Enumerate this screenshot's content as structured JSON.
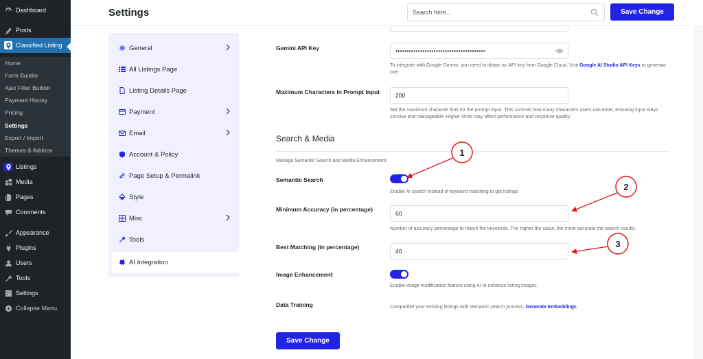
{
  "wp_menu": {
    "items": [
      {
        "id": "dashboard",
        "label": "Dashboard",
        "icon": "dashboard-icon"
      },
      {
        "id": "posts",
        "label": "Posts",
        "icon": "pin-icon"
      },
      {
        "id": "classified",
        "label": "Classified Listing",
        "icon": "location-pin-icon",
        "active": true
      },
      {
        "id": "listings",
        "label": "Listings",
        "icon": "location-pin-icon"
      },
      {
        "id": "media",
        "label": "Media",
        "icon": "media-icon"
      },
      {
        "id": "pages",
        "label": "Pages",
        "icon": "pages-icon"
      },
      {
        "id": "comments",
        "label": "Comments",
        "icon": "comment-icon"
      },
      {
        "id": "appearance",
        "label": "Appearance",
        "icon": "brush-icon"
      },
      {
        "id": "plugins",
        "label": "Plugins",
        "icon": "plug-icon"
      },
      {
        "id": "users",
        "label": "Users",
        "icon": "user-icon"
      },
      {
        "id": "tools",
        "label": "Tools",
        "icon": "wrench-icon"
      },
      {
        "id": "settings",
        "label": "Settings",
        "icon": "sliders-icon"
      },
      {
        "id": "collapse",
        "label": "Collapse Menu",
        "icon": "collapse-icon"
      }
    ],
    "submenu": [
      {
        "label": "Home",
        "current": false
      },
      {
        "label": "Form Builder",
        "current": false
      },
      {
        "label": "Ajax Filter Builder",
        "current": false
      },
      {
        "label": "Payment History",
        "current": false
      },
      {
        "label": "Pricing",
        "current": false
      },
      {
        "label": "Settings",
        "current": true
      },
      {
        "label": "Export / Import",
        "current": false
      },
      {
        "label": "Themes & Addons",
        "current": false
      }
    ]
  },
  "header": {
    "title": "Settings",
    "search_placeholder": "Search here...",
    "save_label": "Save Change"
  },
  "nav": {
    "items": [
      {
        "label": "General",
        "icon": "gear-icon",
        "has_children": true
      },
      {
        "label": "All Listings Page",
        "icon": "list-icon",
        "has_children": false
      },
      {
        "label": "Listing Details Page",
        "icon": "document-icon",
        "has_children": false
      },
      {
        "label": "Payment",
        "icon": "credit-card-icon",
        "has_children": true
      },
      {
        "label": "Email",
        "icon": "envelope-icon",
        "has_children": true
      },
      {
        "label": "Account & Policy",
        "icon": "shield-icon",
        "has_children": false
      },
      {
        "label": "Page Setup & Permalink",
        "icon": "link-icon",
        "has_children": false
      },
      {
        "label": "Style",
        "icon": "paint-bucket-icon",
        "has_children": false
      },
      {
        "label": "Misc",
        "icon": "grid-icon",
        "has_children": true
      },
      {
        "label": "Tools",
        "icon": "wrench-icon",
        "has_children": false
      },
      {
        "label": "AI Integration",
        "icon": "ai-chip-icon",
        "has_children": false,
        "active": true
      }
    ]
  },
  "content": {
    "gemini": {
      "label": "Gemini API Key",
      "value": "••••••••••••••••••••••••••••••••••••••••",
      "help_prefix": "To integrate with Google Gemini, you need to obtain an API key from Google Cloud. Visit ",
      "help_link": "Google AI Studio API Keys",
      "help_suffix": " to generate one."
    },
    "max_chars": {
      "label": "Maximum Characters in Prompt Input",
      "value": "200",
      "help": "Set the maximum character limit for the prompt input. This controls how many characters users can enter, ensuring input stays concise and manageable. Higher limits may affect performance and response quality."
    },
    "section": {
      "title": "Search & Media",
      "description": "Manage Semantic Search and Media Enhancement."
    },
    "semantic": {
      "label": "Semantic Search",
      "enabled": true,
      "help": "Enable AI search instead of keyword matching to get listings"
    },
    "min_accuracy": {
      "label": "Minimum Accuracy (in percentage)",
      "value": "60",
      "help": "Number of accuracy percentage to match the keywords. The higher the value, the more accurate the search results."
    },
    "best_matching": {
      "label": "Best Matching (in percentage)",
      "value": "40"
    },
    "image_enh": {
      "label": "Image Enhancement",
      "enabled": true,
      "help": "Enable image modification feature using AI to enhance listing images."
    },
    "data_training": {
      "label": "Data Training",
      "help_prefix": "Compatible your existing listings with semantic search process. ",
      "help_link": "Generate Embeddings"
    },
    "save_label": "Save Change"
  },
  "annotations": [
    {
      "number": "1"
    },
    {
      "number": "2"
    },
    {
      "number": "3"
    }
  ],
  "colors": {
    "accent": "#2323e6",
    "annotation": "#e0121b",
    "sidebar": "#1d2327",
    "active_menu": "#2271b1"
  }
}
